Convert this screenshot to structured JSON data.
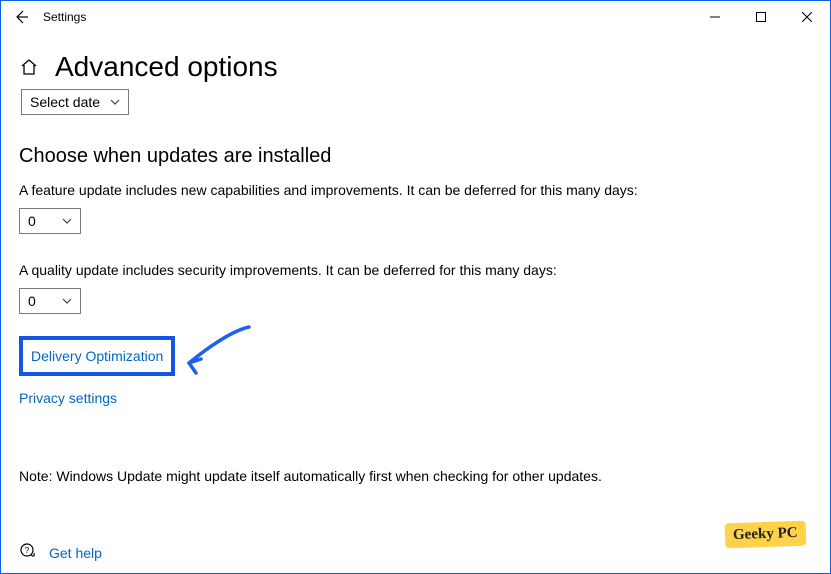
{
  "window": {
    "title": "Settings"
  },
  "page": {
    "title": "Advanced options"
  },
  "date_dropdown": {
    "label": "Select date"
  },
  "section": {
    "heading": "Choose when updates are installed"
  },
  "feature_update": {
    "text": "A feature update includes new capabilities and improvements. It can be deferred for this many days:",
    "value": "0"
  },
  "quality_update": {
    "text": "A quality update includes security improvements. It can be deferred for this many days:",
    "value": "0"
  },
  "links": {
    "delivery": "Delivery Optimization",
    "privacy": "Privacy settings",
    "help": "Get help"
  },
  "note": "Note: Windows Update might update itself automatically first when checking for other updates.",
  "watermark": "Geeky PC"
}
